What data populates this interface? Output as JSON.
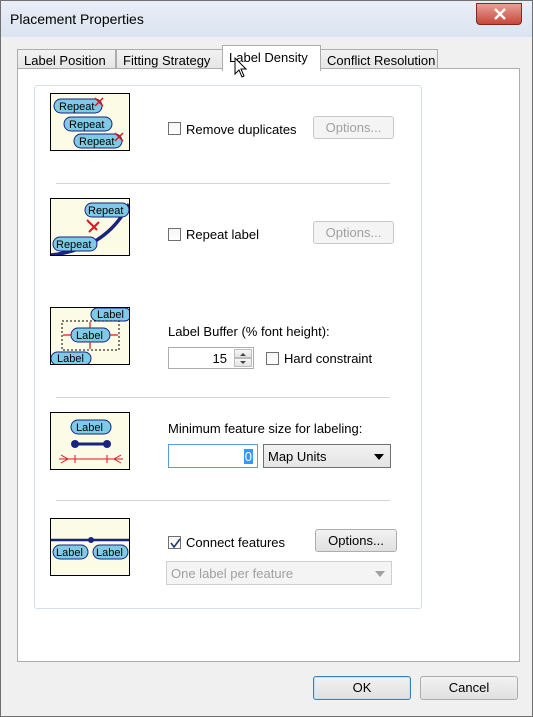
{
  "window": {
    "title": "Placement Properties"
  },
  "tabs": [
    "Label Position",
    "Fitting Strategy",
    "Label Density",
    "Conflict Resolution"
  ],
  "sections": {
    "remove_duplicates": {
      "label": "Remove duplicates",
      "checked": false,
      "options_label": "Options...",
      "icon_labels": [
        "Repeat",
        "Repeat",
        "Repeat"
      ]
    },
    "repeat_label": {
      "label": "Repeat label",
      "checked": false,
      "options_label": "Options...",
      "icon_labels": [
        "Repeat",
        "Repeat"
      ]
    },
    "label_buffer": {
      "label": "Label Buffer (% font height):",
      "value": "15",
      "hard_constraint_label": "Hard constraint",
      "hard_constraint_checked": false,
      "icon_labels": [
        "Label",
        "Label",
        "Label"
      ]
    },
    "min_feature_size": {
      "label": "Minimum feature size for labeling:",
      "value": "0",
      "units": "Map Units",
      "icon_labels": [
        "Label"
      ]
    },
    "connect_features": {
      "label": "Connect features",
      "checked": true,
      "options_label": "Options...",
      "dropdown_value": "One label per feature",
      "icon_labels": [
        "Label",
        "Label"
      ]
    }
  },
  "buttons": {
    "ok": "OK",
    "cancel": "Cancel"
  },
  "colors": {
    "label_fill": "#7fcbe5",
    "red_marker": "#e0141e",
    "navy_line": "#1a237e",
    "thumb_bg": "#fbfbe6"
  }
}
